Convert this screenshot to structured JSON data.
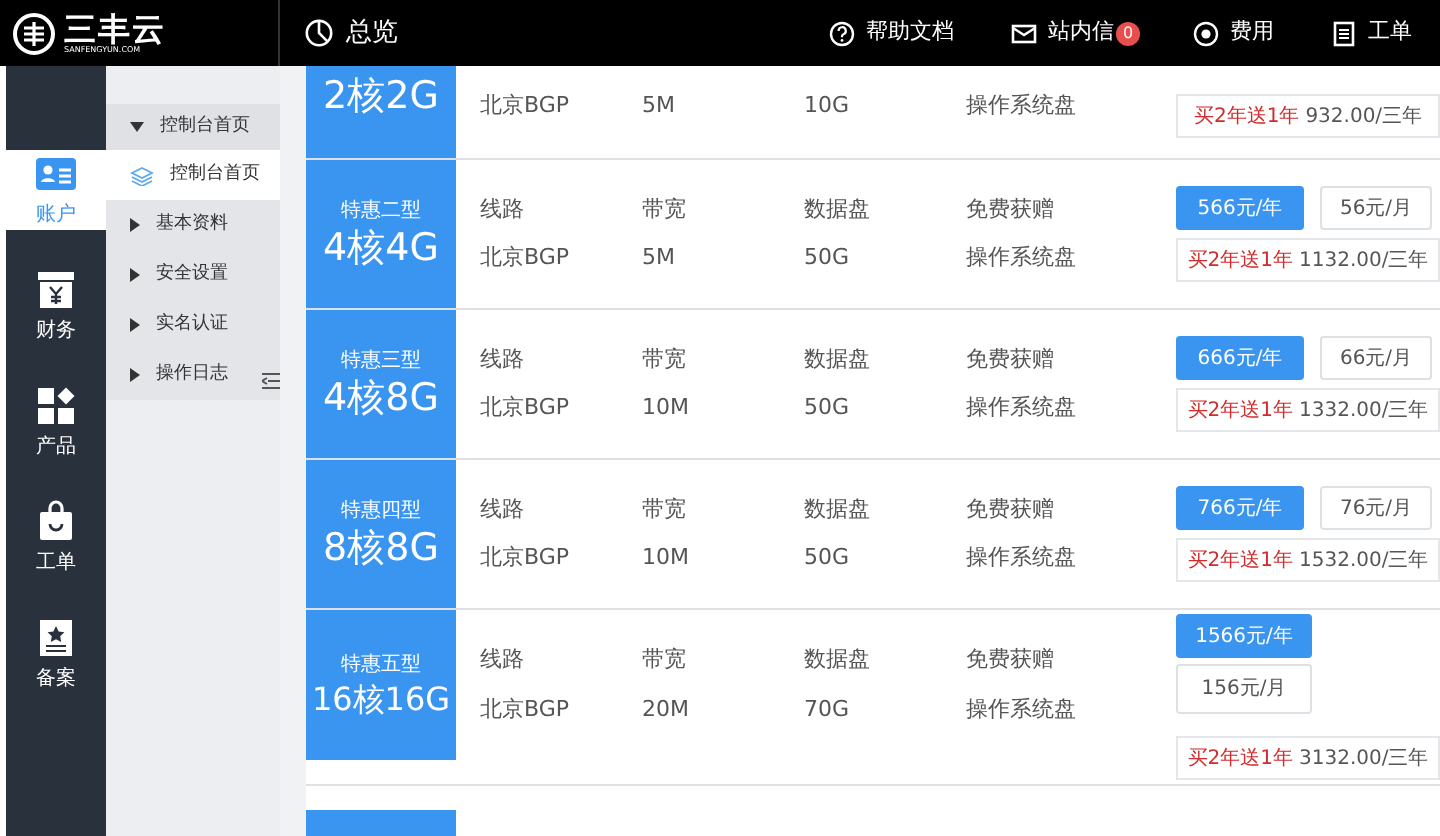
{
  "topbar": {
    "logo_text": "三丰云",
    "logo_sub": "SANFENGYUN.COM",
    "page_title": "总览",
    "links": [
      {
        "kind": "help",
        "label": "帮助文档"
      },
      {
        "kind": "mail",
        "label": "站内信",
        "badge": "0"
      },
      {
        "kind": "fee",
        "label": "费用"
      },
      {
        "kind": "ticket",
        "label": "工单"
      }
    ]
  },
  "sidebar": {
    "items": [
      {
        "kind": "account",
        "label": "账户",
        "selected": true
      },
      {
        "kind": "finance",
        "label": "财务",
        "selected": false
      },
      {
        "kind": "product",
        "label": "产品",
        "selected": false
      },
      {
        "kind": "ticket",
        "label": "工单",
        "selected": false
      },
      {
        "kind": "filing",
        "label": "备案",
        "selected": false
      }
    ]
  },
  "submenu": {
    "header": "控制台首页",
    "items": [
      {
        "label": "控制台首页",
        "selected": true
      },
      {
        "label": "基本资料",
        "selected": false
      },
      {
        "label": "安全设置",
        "selected": false
      },
      {
        "label": "实名认证",
        "selected": false
      },
      {
        "label": "操作日志",
        "selected": false
      }
    ]
  },
  "plans": [
    {
      "kind": "partial",
      "spec": "2核2G",
      "values": [
        "北京BGP",
        "5M",
        "10G",
        "操作系统盘"
      ],
      "promo": "买2年送1年",
      "promo_price": "932.00/三年"
    },
    {
      "kind": "full",
      "tag": "特惠二型",
      "spec": "4核4G",
      "labels": [
        "线路",
        "带宽",
        "数据盘",
        "免费获赠"
      ],
      "values": [
        "北京BGP",
        "5M",
        "50G",
        "操作系统盘"
      ],
      "year_price": "566元/年",
      "month_price": "56元/月",
      "promo": "买2年送1年",
      "promo_price": "1132.00/三年"
    },
    {
      "kind": "full",
      "tag": "特惠三型",
      "spec": "4核8G",
      "labels": [
        "线路",
        "带宽",
        "数据盘",
        "免费获赠"
      ],
      "values": [
        "北京BGP",
        "10M",
        "50G",
        "操作系统盘"
      ],
      "year_price": "666元/年",
      "month_price": "66元/月",
      "promo": "买2年送1年",
      "promo_price": "1332.00/三年"
    },
    {
      "kind": "full",
      "tag": "特惠四型",
      "spec": "8核8G",
      "labels": [
        "线路",
        "带宽",
        "数据盘",
        "免费获赠"
      ],
      "values": [
        "北京BGP",
        "10M",
        "50G",
        "操作系统盘"
      ],
      "year_price": "766元/年",
      "month_price": "76元/月",
      "promo": "买2年送1年",
      "promo_price": "1532.00/三年"
    },
    {
      "kind": "stacked",
      "tag": "特惠五型",
      "spec": "16核16G",
      "labels": [
        "线路",
        "带宽",
        "数据盘",
        "免费获赠"
      ],
      "values": [
        "北京BGP",
        "20M",
        "70G",
        "操作系统盘"
      ],
      "year_price": "1566元/年",
      "month_price": "156元/月",
      "promo": "买2年送1年",
      "promo_price": "3132.00/三年"
    },
    {
      "kind": "cut"
    }
  ]
}
